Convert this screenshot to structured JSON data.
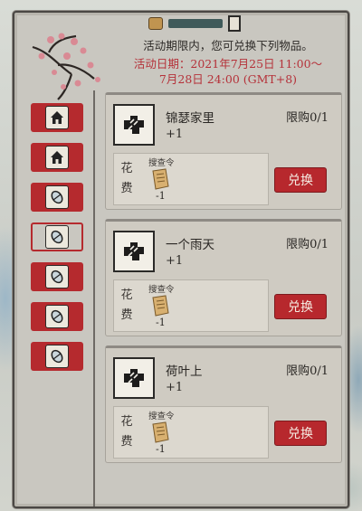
{
  "header": {
    "notice": "活动期限内，您可兑换下列物品。",
    "period_line1": "活动日期：2021年7月25日 11:00～",
    "period_line2": "7月28日 24:00 (GMT+8)"
  },
  "colors": {
    "accent_red": "#b52a2e",
    "period_text": "#b5323a",
    "panel_bg": "#c9c7c0"
  },
  "sidebar": {
    "tabs": [
      {
        "icon": "house-icon",
        "selected": false
      },
      {
        "icon": "house-icon",
        "selected": false
      },
      {
        "icon": "scroll-bundle-icon",
        "selected": false
      },
      {
        "icon": "scroll-bundle-icon",
        "selected": true
      },
      {
        "icon": "scroll-bundle-icon",
        "selected": false
      },
      {
        "icon": "scroll-bundle-icon",
        "selected": false
      },
      {
        "icon": "scroll-bundle-icon",
        "selected": false
      }
    ]
  },
  "items": [
    {
      "name": "锦瑟家里",
      "quantity": "+1",
      "limit": "限购0/1",
      "cost_label": "花费",
      "cost_item": "搜查令",
      "cost_amount": "-1",
      "button": "兑换"
    },
    {
      "name": "一个雨天",
      "quantity": "+1",
      "limit": "限购0/1",
      "cost_label": "花费",
      "cost_item": "搜查令",
      "cost_amount": "-1",
      "button": "兑换"
    },
    {
      "name": "荷叶上",
      "quantity": "+1",
      "limit": "限购0/1",
      "cost_label": "花费",
      "cost_item": "搜查令",
      "cost_amount": "-1",
      "button": "兑换"
    }
  ]
}
